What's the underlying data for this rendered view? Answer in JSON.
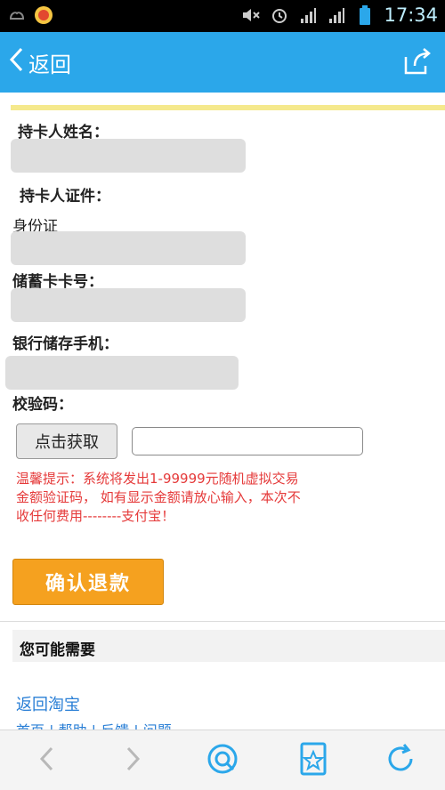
{
  "status_bar": {
    "time": "17:34",
    "icons": [
      "notification-icon",
      "app-icon",
      "mute-icon",
      "alarm-icon",
      "signal-icon",
      "signal-icon",
      "battery-icon"
    ]
  },
  "nav": {
    "back_label": "返回",
    "share_icon": "share-icon"
  },
  "form": {
    "name_label": "持卡人姓名：",
    "id_label": "持卡人证件：",
    "id_type": "身份证",
    "card_label": "储蓄卡卡号：",
    "phone_label": "银行储存手机：",
    "code_label": "校验码：",
    "get_code_button": "点击获取",
    "code_placeholder": ""
  },
  "warning": "温馨提示：系统将发出1-99999元随机虚拟交易金额验证码， 如有显示金额请放心输入，本次不收任何费用--------支付宝！",
  "confirm_button": "确认退款",
  "section": {
    "title": "您可能需要",
    "link_back": "返回淘宝",
    "link_more": "首页 | 帮助 | 反馈 | 问题"
  },
  "colors": {
    "nav_bg": "#2ba7ea",
    "confirm_bg": "#f5a11f",
    "warning": "#e53a3a",
    "link": "#2a7fd6"
  }
}
